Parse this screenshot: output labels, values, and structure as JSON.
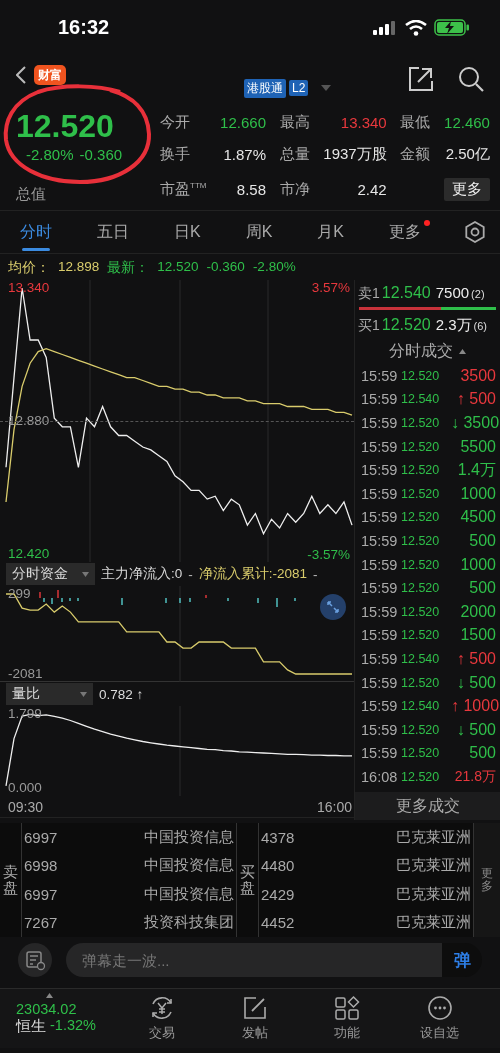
{
  "status_bar": {
    "time": "16:32"
  },
  "header": {
    "logo": "财富",
    "badges": [
      {
        "label": "港股通"
      },
      {
        "label": "L2"
      }
    ]
  },
  "quote": {
    "price": "12.520",
    "change_pct": "-2.80%",
    "change": "-0.360",
    "market_cap_label": "总值",
    "stats": [
      {
        "label": "今开",
        "value": "12.660",
        "color": "#2fbf4a"
      },
      {
        "label": "最高",
        "value": "13.340",
        "color": "#e8383d"
      },
      {
        "label": "最低",
        "value": "12.460",
        "color": "#2fbf4a"
      },
      {
        "label": "换手",
        "value": "1.87%",
        "color": "#e6e6e6"
      },
      {
        "label": "总量",
        "value": "1937万股",
        "color": "#e6e6e6"
      },
      {
        "label": "金额",
        "value": "2.50亿",
        "color": "#e6e6e6"
      },
      {
        "label": "市盈$^{TTM}$",
        "value": "8.58",
        "color": "#e6e6e6"
      },
      {
        "label": "市净",
        "value": "2.42",
        "color": "#e6e6e6"
      }
    ],
    "more_button": "更多"
  },
  "tabs": [
    {
      "label": "分时",
      "selected": true,
      "dot": false
    },
    {
      "label": "五日",
      "selected": false,
      "dot": false
    },
    {
      "label": "日K",
      "selected": false,
      "dot": false
    },
    {
      "label": "周K",
      "selected": false,
      "dot": false
    },
    {
      "label": "月K",
      "selected": false,
      "dot": false
    },
    {
      "label": "更多",
      "selected": false,
      "dot": true
    }
  ],
  "summary": {
    "avg_label": "均价：",
    "avg": "12.898",
    "latest_label": "最新：",
    "latest": "12.520",
    "change": "-0.360",
    "change_pct": "-2.80%"
  },
  "price_chart": {
    "high_pct": "3.57%",
    "low_pct": "-3.57%",
    "chart_data": {
      "type": "line",
      "ylim": [
        12.42,
        13.34
      ],
      "yticks": [
        {
          "value": 13.34,
          "label": "13.340"
        },
        {
          "value": 12.88,
          "label": "12.880"
        },
        {
          "value": 12.42,
          "label": "12.420"
        }
      ],
      "series": [
        {
          "color": "#eeeeee",
          "values": [
            12.72,
            13.03,
            13.34,
            13.16,
            13.16,
            13.1,
            12.89,
            12.86,
            12.86,
            12.72,
            12.89,
            12.86,
            12.93,
            12.86,
            12.83,
            12.83,
            12.81,
            12.79,
            12.78,
            12.76,
            12.74,
            12.69,
            12.67,
            12.64,
            12.64,
            12.61,
            12.62,
            12.57,
            12.61,
            12.59,
            12.52,
            12.56,
            12.49,
            12.54,
            12.51,
            12.56,
            12.53,
            12.56,
            12.62,
            12.56,
            12.59,
            12.56,
            12.6,
            12.52
          ]
        },
        {
          "color": "#d9cc6c",
          "values": [
            12.6,
            12.85,
            13.0,
            13.08,
            13.12,
            13.13,
            13.12,
            13.11,
            13.1,
            13.09,
            13.08,
            13.07,
            13.06,
            13.05,
            13.04,
            13.03,
            13.03,
            13.02,
            13.01,
            13.0,
            13.0,
            12.99,
            12.99,
            12.98,
            12.98,
            12.97,
            12.97,
            12.96,
            12.96,
            12.96,
            12.95,
            12.95,
            12.94,
            12.94,
            12.94,
            12.93,
            12.93,
            12.93,
            12.92,
            12.92,
            12.92,
            12.91,
            12.91,
            12.9
          ]
        }
      ]
    }
  },
  "fund_flow": {
    "selector": "分时资金",
    "legend": [
      {
        "text": "主力净流入:0",
        "color": "#d8d8d8"
      },
      {
        "text": "-"
      },
      {
        "text": "净流入累计:-2081",
        "color": "#d9cc6c"
      },
      {
        "text": "-"
      }
    ],
    "chart_data": {
      "type": "line",
      "ylim": [
        -2081,
        299
      ],
      "yticks": [
        {
          "value": 299,
          "label": "299"
        },
        {
          "value": -2081,
          "label": "-2081"
        }
      ],
      "series": [
        {
          "color": "#d9cc6c",
          "values": [
            299,
            299,
            -120,
            -180,
            -180,
            0,
            -240,
            -60,
            -240,
            -530,
            -530,
            -530,
            -530,
            -530,
            -530,
            -830,
            -830,
            -830,
            -830,
            -830,
            -1130,
            -1130,
            -1310,
            -1310,
            -1130,
            -1130,
            -1130,
            -1130,
            -1310,
            -1310,
            -1310,
            -1310,
            -1720,
            -1720,
            -1720,
            -1960,
            -2080,
            -2080,
            -2080,
            -2080,
            -2080,
            -2080,
            -2080,
            -2080
          ]
        }
      ]
    }
  },
  "volume_ratio": {
    "selector": "量比",
    "value": "0.782 ↑",
    "chart_data": {
      "type": "line",
      "ylim": [
        0,
        1.799
      ],
      "yticks": [
        {
          "value": 1.799,
          "label": "1.799"
        },
        {
          "value": 0,
          "label": "0.000"
        }
      ],
      "series": [
        {
          "color": "#eeeeee",
          "values": [
            0.05,
            1.2,
            1.75,
            1.79,
            1.76,
            1.78,
            1.74,
            1.7,
            1.64,
            1.57,
            1.5,
            1.43,
            1.37,
            1.31,
            1.26,
            1.21,
            1.17,
            1.13,
            1.1,
            1.07,
            1.04,
            1.02,
            1.0,
            0.98,
            0.96,
            0.94,
            0.93,
            0.91,
            0.9,
            0.88,
            0.87,
            0.86,
            0.85,
            0.84,
            0.83,
            0.82,
            0.82,
            0.81,
            0.8,
            0.8,
            0.79,
            0.79,
            0.78,
            0.78
          ]
        }
      ]
    }
  },
  "time_axis": {
    "start": "09:30",
    "end": "16:00"
  },
  "order_book": [
    {
      "label": "卖1",
      "price": "12.540",
      "volume": "7500",
      "count": "(2)"
    },
    {
      "label": "买1",
      "price": "12.520",
      "volume": "2.3万",
      "count": "(6)"
    }
  ],
  "order_ratio": {
    "level": 0.6
  },
  "trades_title": "分时成交",
  "trades": [
    {
      "time": "15:59",
      "price": "12.520",
      "volume": "3500",
      "color": "#e8383d"
    },
    {
      "time": "15:59",
      "price": "12.540",
      "arrow": "↑",
      "volume": "500",
      "color": "#e8383d"
    },
    {
      "time": "15:59",
      "price": "12.520",
      "arrow": "↓",
      "volume": "3500",
      "color": "#2fbf4a"
    },
    {
      "time": "15:59",
      "price": "12.520",
      "volume": "5500",
      "color": "#2fbf4a"
    },
    {
      "time": "15:59",
      "price": "12.520",
      "volume": "1.4万",
      "color": "#2fbf4a"
    },
    {
      "time": "15:59",
      "price": "12.520",
      "volume": "1000",
      "color": "#2fbf4a"
    },
    {
      "time": "15:59",
      "price": "12.520",
      "volume": "4500",
      "color": "#2fbf4a"
    },
    {
      "time": "15:59",
      "price": "12.520",
      "volume": "500",
      "color": "#2fbf4a"
    },
    {
      "time": "15:59",
      "price": "12.520",
      "volume": "1000",
      "color": "#2fbf4a"
    },
    {
      "time": "15:59",
      "price": "12.520",
      "volume": "500",
      "color": "#2fbf4a"
    },
    {
      "time": "15:59",
      "price": "12.520",
      "volume": "2000",
      "color": "#2fbf4a"
    },
    {
      "time": "15:59",
      "price": "12.520",
      "volume": "1500",
      "color": "#2fbf4a"
    },
    {
      "time": "15:59",
      "price": "12.540",
      "arrow": "↑",
      "volume": "500",
      "color": "#e8383d"
    },
    {
      "time": "15:59",
      "price": "12.520",
      "arrow": "↓",
      "volume": "500",
      "color": "#2fbf4a"
    },
    {
      "time": "15:59",
      "price": "12.540",
      "arrow": "↑",
      "volume": "1000",
      "color": "#e8383d"
    },
    {
      "time": "15:59",
      "price": "12.520",
      "arrow": "↓",
      "volume": "500",
      "color": "#2fbf4a"
    },
    {
      "time": "15:59",
      "price": "12.520",
      "volume": "500",
      "color": "#2fbf4a"
    },
    {
      "time": "16:08",
      "price": "12.520",
      "volume": "21.8万",
      "color": "#e8383d"
    }
  ],
  "more_trades": "更多成交",
  "brokers": {
    "sell_label": "卖盘",
    "buy_label": "买盘",
    "more": "更多",
    "rows": [
      {
        "sell_id": "6997",
        "sell_name": "中国投资信息",
        "buy_id": "4378",
        "buy_name": "巴克莱亚洲"
      },
      {
        "sell_id": "6998",
        "sell_name": "中国投资信息",
        "buy_id": "4480",
        "buy_name": "巴克莱亚洲"
      },
      {
        "sell_id": "6997",
        "sell_name": "中国投资信息",
        "buy_id": "2429",
        "buy_name": "巴克莱亚洲"
      },
      {
        "sell_id": "7267",
        "sell_name": "投资科技集团",
        "buy_id": "4452",
        "buy_name": "巴克莱亚洲"
      }
    ]
  },
  "comment": {
    "placeholder": "弹幕走一波...",
    "send": "弹"
  },
  "index": {
    "value": "23034.02",
    "name": "恒生",
    "change": "-1.32%"
  },
  "nav": [
    {
      "label": "交易",
      "kind": "trade"
    },
    {
      "label": "发帖",
      "kind": "post"
    },
    {
      "label": "功能",
      "kind": "apps"
    },
    {
      "label": "设自选",
      "kind": "more"
    }
  ]
}
